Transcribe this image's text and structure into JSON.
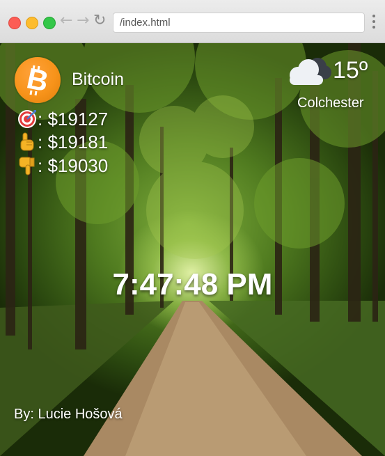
{
  "browser": {
    "url": "/index.html"
  },
  "crypto": {
    "name": "Bitcoin",
    "icon": "bitcoin-icon",
    "current_price": ": $19127",
    "high_price": ": $19181",
    "low_price": ": $19030",
    "current_icon": "target-icon",
    "high_icon": "pointing-up-icon",
    "low_icon": "thumbs-down-icon"
  },
  "weather": {
    "icon": "cloud-icon",
    "temperature": "15º",
    "city": "Colchester"
  },
  "clock": {
    "time": "7:47:48 PM"
  },
  "footer": {
    "author": "By: Lucie Hošová"
  },
  "colors": {
    "bitcoin_orange": "#f7931a",
    "text": "#ffffff"
  }
}
